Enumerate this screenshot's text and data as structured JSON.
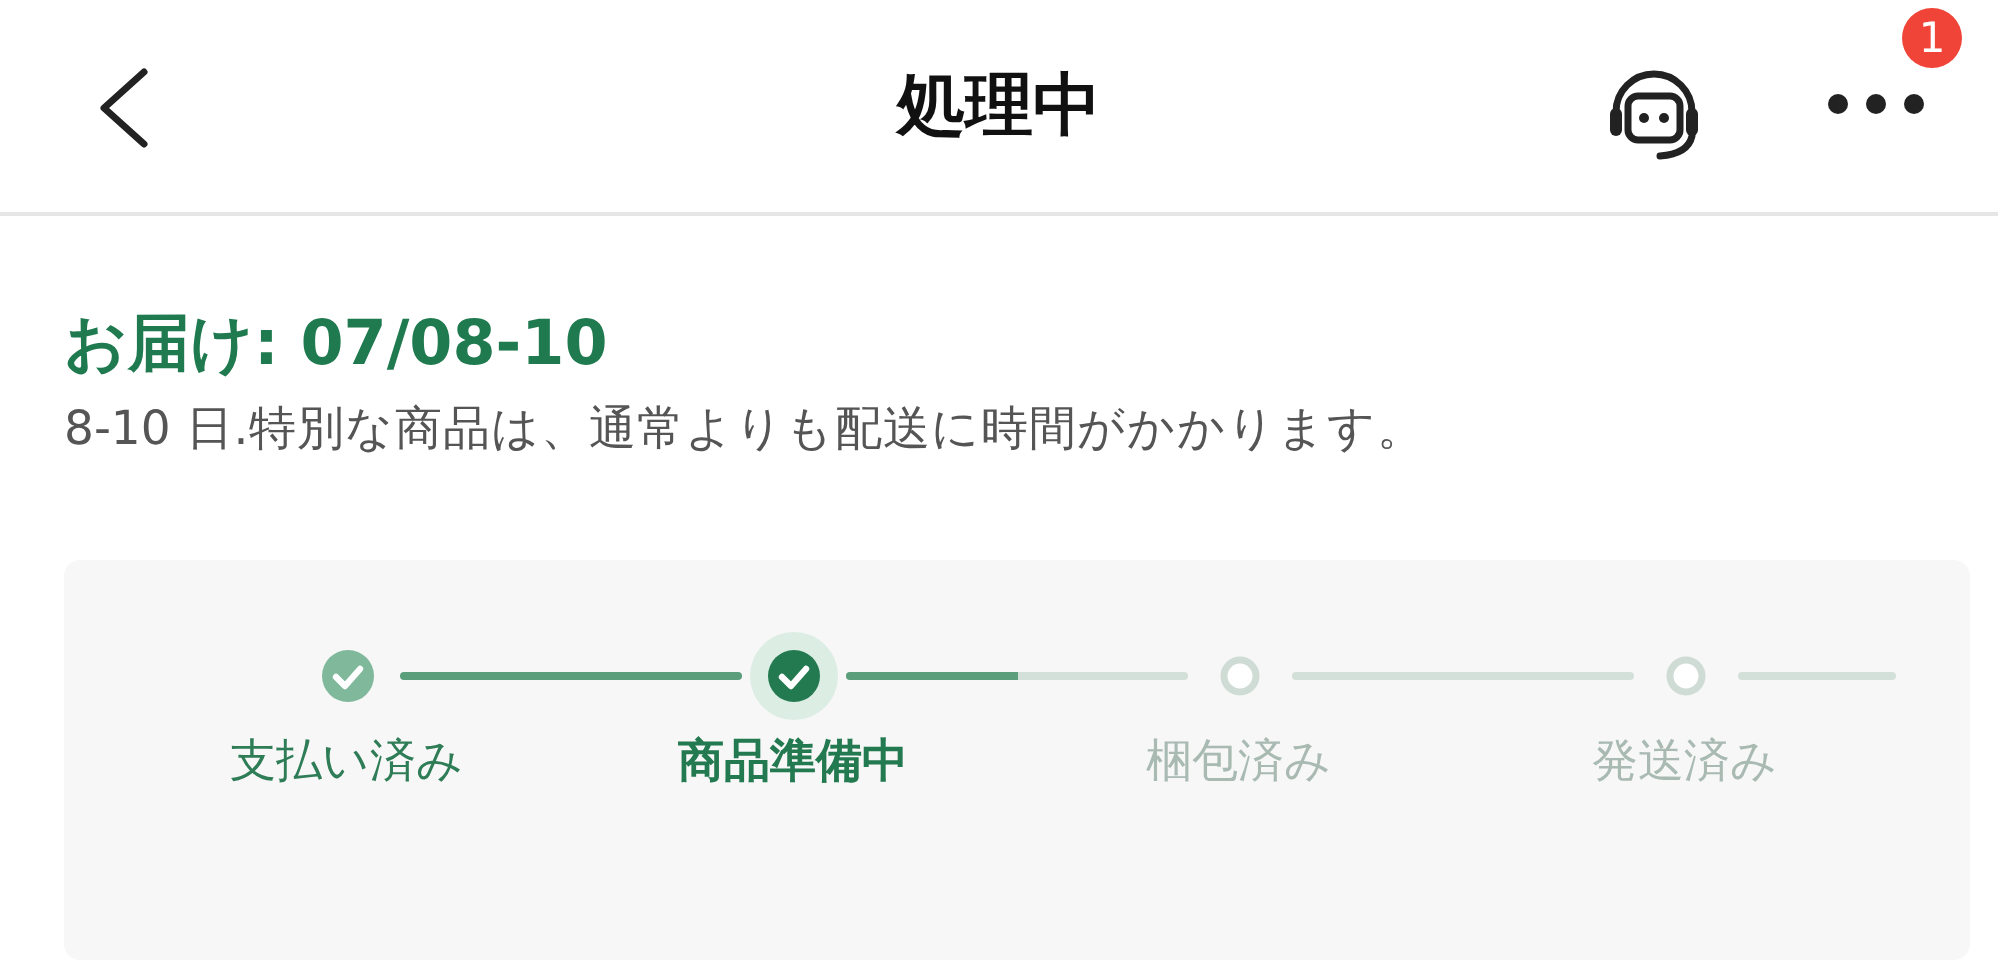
{
  "header": {
    "title": "処理中",
    "badge": "1"
  },
  "delivery": {
    "title": "お届け: 07/08-10",
    "note": "8-10 日.特別な商品は、通常よりも配送に時間がかかります。"
  },
  "steps": [
    {
      "label": "支払い済み",
      "done": true,
      "selected": false,
      "level": 1
    },
    {
      "label": "商品準備中",
      "done": true,
      "selected": true,
      "level": 0.5
    },
    {
      "label": "梱包済み",
      "done": false,
      "selected": false,
      "level": 0
    },
    {
      "label": "発送済み",
      "done": false,
      "selected": false,
      "level": 0
    }
  ]
}
